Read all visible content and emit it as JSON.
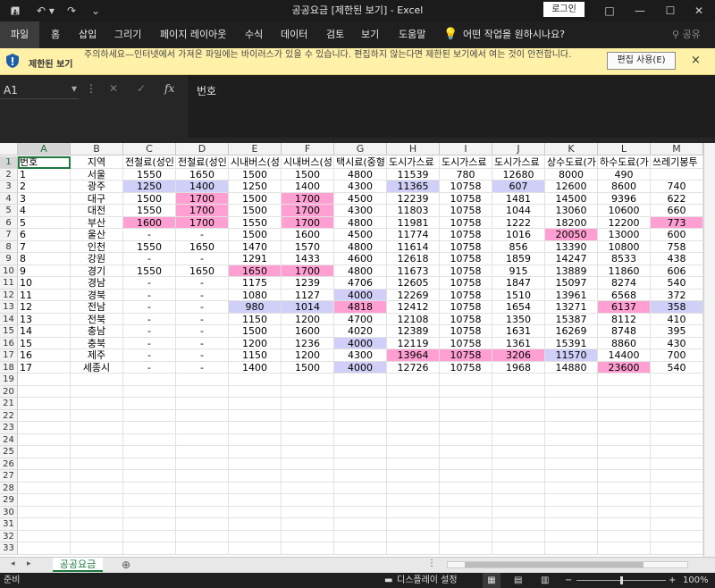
{
  "titlebar": {
    "title": "공공요금  [제한된 보기]  -  Excel",
    "login_label": "로그인",
    "icons": [
      "save-icon",
      "undo-icon",
      "redo-icon",
      "customize-icon"
    ],
    "restore_glyph": "□",
    "minimize_glyph": "—",
    "maximize_glyph": "☐",
    "close_glyph": "✕"
  },
  "ribbon": {
    "tabs": [
      "파일",
      "홈",
      "삽입",
      "그리기",
      "페이지 레이아웃",
      "수식",
      "데이터",
      "검토",
      "보기",
      "도움말"
    ],
    "tellme": "어떤 작업을 원하시나요?",
    "share": "공유"
  },
  "message": {
    "title": "제한된 보기",
    "text": "주의하세요—인터넷에서 가져온 파일에는 바이러스가 있을 수 있습니다. 편집하지 않는다면 제한된 보기에서 여는 것이 안전합니다.",
    "button": "편집 사용(E)",
    "close": "×"
  },
  "formula": {
    "namebox": "A1",
    "value": "번호"
  },
  "grid": {
    "columns": [
      "A",
      "B",
      "C",
      "D",
      "E",
      "F",
      "G",
      "H",
      "I",
      "J",
      "K",
      "L",
      "M"
    ],
    "rows": [
      [
        "번호",
        "지역",
        "전철료(성인",
        "전철료(성인",
        "시내버스(성",
        "시내버스(성",
        "택시료(중형",
        "도시가스료",
        "도시가스료",
        "도시가스료",
        "상수도료(가",
        "하수도료(가",
        "쓰레기봉투"
      ],
      [
        "1",
        "서울",
        "1550",
        "1650",
        "1500",
        "1500",
        "4800",
        "11539",
        "780",
        "12680",
        "8000",
        "490",
        ""
      ],
      [
        "2",
        "광주",
        "1250",
        "1400",
        "1250",
        "1400",
        "4300",
        "11365",
        "10758",
        "607",
        "12600",
        "8600",
        "740"
      ],
      [
        "3",
        "대구",
        "1500",
        "1700",
        "1500",
        "1700",
        "4500",
        "12239",
        "10758",
        "1481",
        "14500",
        "9396",
        "622"
      ],
      [
        "4",
        "대전",
        "1550",
        "1700",
        "1500",
        "1700",
        "4300",
        "11803",
        "10758",
        "1044",
        "13060",
        "10600",
        "660"
      ],
      [
        "5",
        "부산",
        "1600",
        "1700",
        "1550",
        "1700",
        "4800",
        "11981",
        "10758",
        "1222",
        "18200",
        "12200",
        "773"
      ],
      [
        "6",
        "울산",
        "-",
        "-",
        "1500",
        "1600",
        "4500",
        "11774",
        "10758",
        "1016",
        "20050",
        "13000",
        "600"
      ],
      [
        "7",
        "인천",
        "1550",
        "1650",
        "1470",
        "1570",
        "4800",
        "11614",
        "10758",
        "856",
        "13390",
        "10800",
        "758"
      ],
      [
        "8",
        "강원",
        "-",
        "-",
        "1291",
        "1433",
        "4600",
        "12618",
        "10758",
        "1859",
        "14247",
        "8533",
        "438"
      ],
      [
        "9",
        "경기",
        "1550",
        "1650",
        "1650",
        "1700",
        "4800",
        "11673",
        "10758",
        "915",
        "13889",
        "11860",
        "606"
      ],
      [
        "10",
        "경남",
        "-",
        "-",
        "1175",
        "1239",
        "4706",
        "12605",
        "10758",
        "1847",
        "15097",
        "8274",
        "540"
      ],
      [
        "11",
        "경북",
        "-",
        "-",
        "1080",
        "1127",
        "4000",
        "12269",
        "10758",
        "1510",
        "13961",
        "6568",
        "372"
      ],
      [
        "12",
        "전남",
        "-",
        "-",
        "980",
        "1014",
        "4818",
        "12412",
        "10758",
        "1654",
        "13271",
        "6137",
        "358"
      ],
      [
        "13",
        "전북",
        "-",
        "-",
        "1150",
        "1200",
        "4700",
        "12108",
        "10758",
        "1350",
        "15387",
        "8112",
        "410"
      ],
      [
        "14",
        "충남",
        "-",
        "-",
        "1500",
        "1600",
        "4020",
        "12389",
        "10758",
        "1631",
        "16269",
        "8748",
        "395"
      ],
      [
        "15",
        "충북",
        "-",
        "-",
        "1200",
        "1236",
        "4000",
        "12119",
        "10758",
        "1361",
        "15391",
        "8860",
        "430"
      ],
      [
        "16",
        "제주",
        "-",
        "-",
        "1150",
        "1200",
        "4300",
        "13964",
        "10758",
        "3206",
        "11570",
        "14400",
        "700"
      ],
      [
        "17",
        "세종시",
        "-",
        "-",
        "1400",
        "1500",
        "4000",
        "12726",
        "10758",
        "1968",
        "14880",
        "23600",
        "540"
      ]
    ],
    "row_headers": [
      "1",
      "2",
      "3",
      "4",
      "5",
      "6",
      "7",
      "8",
      "9",
      "10",
      "11",
      "12",
      "13",
      "14",
      "15",
      "16",
      "17",
      "18",
      "19",
      "20",
      "21",
      "22",
      "23",
      "24",
      "25",
      "26",
      "27",
      "28",
      "29",
      "30",
      "31",
      "32",
      "33"
    ]
  },
  "sheets": {
    "active": "공공요금"
  },
  "status": {
    "ready": "준비",
    "display": "디스플레이 설정",
    "zoom": "100%"
  },
  "colors": {
    "pink": "#ff9fd2",
    "lavender": "#cfcff7",
    "accent": "#1d7a3f"
  }
}
